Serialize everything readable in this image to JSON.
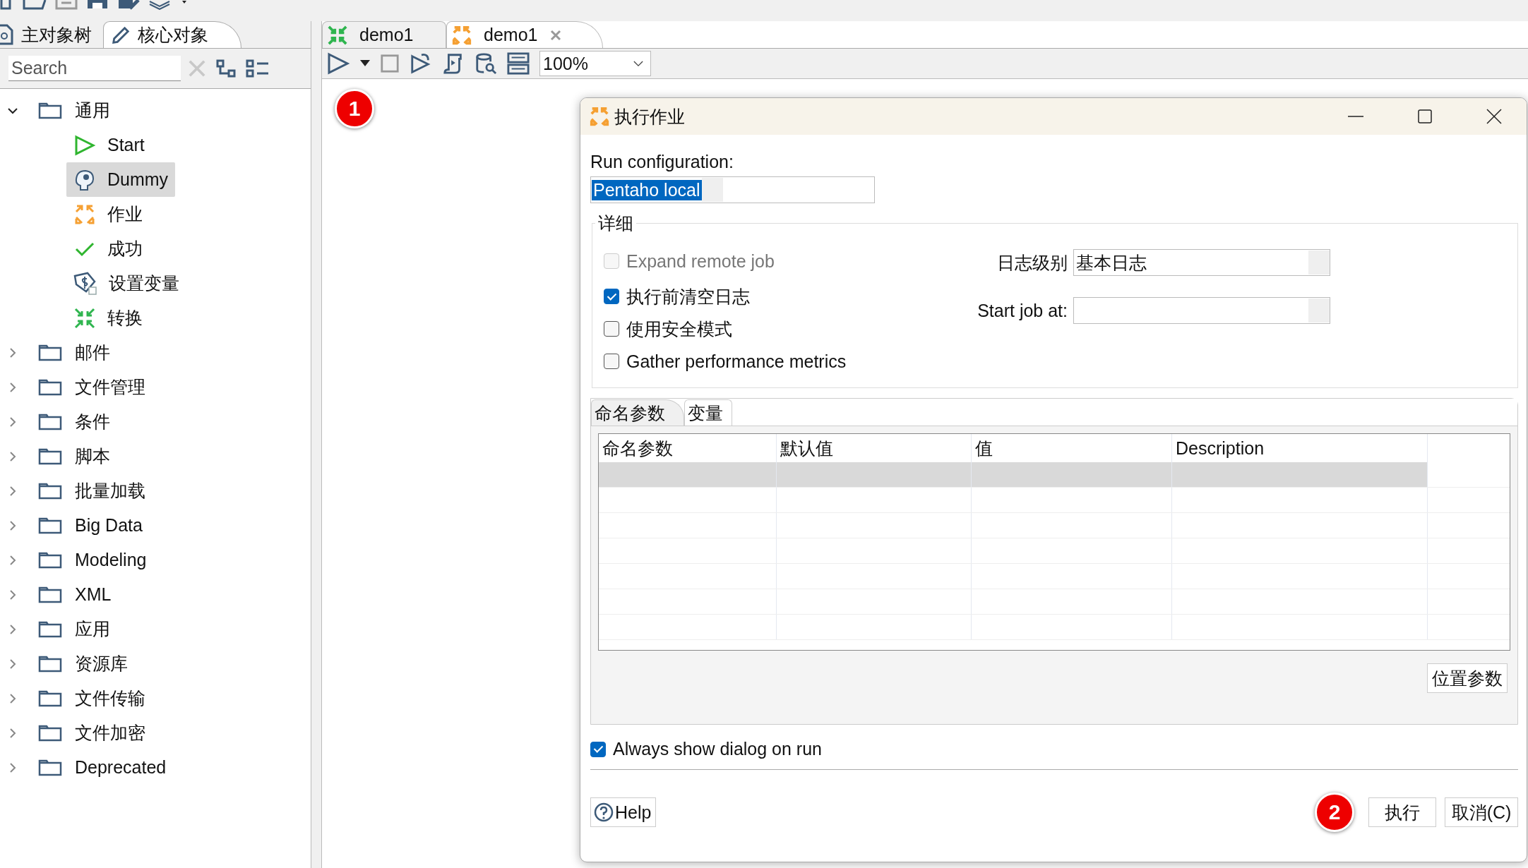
{
  "left_panel": {
    "tabs": [
      {
        "label": "主对象树",
        "selected": false
      },
      {
        "label": "核心对象",
        "selected": true
      }
    ],
    "search": {
      "placeholder": "Search"
    },
    "tree": [
      {
        "label": "通用",
        "expanded": true,
        "selected": false,
        "children": [
          {
            "label": "Start",
            "kind": "start",
            "selected": false
          },
          {
            "label": "Dummy",
            "kind": "dummy",
            "selected": true
          },
          {
            "label": "作业",
            "kind": "job",
            "selected": false
          },
          {
            "label": "成功",
            "kind": "success",
            "selected": false
          },
          {
            "label": "设置变量",
            "kind": "variable",
            "selected": false
          },
          {
            "label": "转换",
            "kind": "transformation",
            "selected": false
          }
        ]
      },
      {
        "label": "邮件",
        "expanded": false,
        "selected": false
      },
      {
        "label": "文件管理",
        "expanded": false,
        "selected": false
      },
      {
        "label": "条件",
        "expanded": false,
        "selected": false
      },
      {
        "label": "脚本",
        "expanded": false,
        "selected": false
      },
      {
        "label": "批量加载",
        "expanded": false,
        "selected": false
      },
      {
        "label": "Big Data",
        "expanded": false,
        "selected": false
      },
      {
        "label": "Modeling",
        "expanded": false,
        "selected": false
      },
      {
        "label": "XML",
        "expanded": false,
        "selected": false
      },
      {
        "label": "应用",
        "expanded": false,
        "selected": false
      },
      {
        "label": "资源库",
        "expanded": false,
        "selected": false
      },
      {
        "label": "文件传输",
        "expanded": false,
        "selected": false
      },
      {
        "label": "文件加密",
        "expanded": false,
        "selected": false
      },
      {
        "label": "Deprecated",
        "expanded": false,
        "selected": false
      }
    ]
  },
  "editor": {
    "tabs": [
      {
        "label": "demo1",
        "kind": "transformation",
        "selected": false
      },
      {
        "label": "demo1",
        "kind": "job",
        "selected": true
      }
    ],
    "zoom": "100%",
    "badge": "1"
  },
  "dialog": {
    "title": "执行作业",
    "run_configuration_label": "Run configuration:",
    "run_configuration": "Pentaho local",
    "details_title": "详细",
    "options": [
      {
        "label": "Expand remote job",
        "checked": false,
        "disabled": true
      },
      {
        "label": "执行前清空日志",
        "checked": true,
        "disabled": false
      },
      {
        "label": "使用安全模式",
        "checked": false,
        "disabled": false
      },
      {
        "label": "Gather performance metrics",
        "checked": false,
        "disabled": false
      }
    ],
    "log_level_label": "日志级别",
    "log_level": "基本日志",
    "start_job_label": "Start job at:",
    "param_tabs": [
      {
        "label": "命名参数",
        "selected": true
      },
      {
        "label": "变量",
        "selected": false
      }
    ],
    "table": {
      "columns": [
        "命名参数",
        "默认值",
        "值",
        "Description"
      ],
      "rows": [
        {
          "selected": true
        },
        {
          "selected": false
        },
        {
          "selected": false
        },
        {
          "selected": false
        },
        {
          "selected": false
        },
        {
          "selected": false
        },
        {
          "selected": false
        }
      ]
    },
    "positional_button": "位置参数",
    "always_show": {
      "label": "Always show dialog on run",
      "checked": true
    },
    "help": "Help",
    "badge": "2",
    "buttons": [
      "执行",
      "取消(C)"
    ]
  }
}
